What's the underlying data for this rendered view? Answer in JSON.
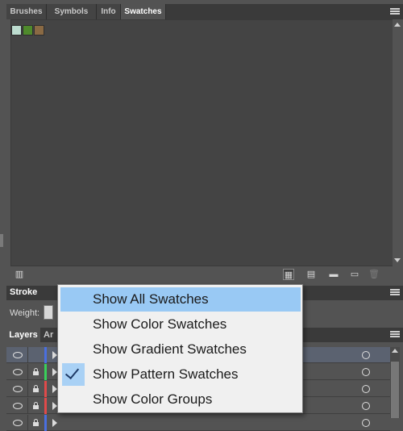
{
  "tabs": [
    {
      "label": "Brushes",
      "active": false
    },
    {
      "label": "Symbols",
      "active": false
    },
    {
      "label": "Info",
      "active": false
    },
    {
      "label": "Swatches",
      "active": true
    }
  ],
  "swatch_thumbnails": [
    {
      "name": "pattern-swatch-1",
      "color": "#bcdccf"
    },
    {
      "name": "pattern-swatch-2",
      "color": "#4f8a2c"
    },
    {
      "name": "pattern-swatch-3",
      "color": "#8a6a44"
    }
  ],
  "stroke_panel": {
    "title": "Stroke",
    "weight_label": "Weight:"
  },
  "layers_panel": {
    "tab_label": "Layers",
    "tab2_label": "Ar",
    "rows": [
      {
        "color": "#4a6fe0",
        "locked": false,
        "selected": true
      },
      {
        "color": "#39d05a",
        "locked": true,
        "selected": false
      },
      {
        "color": "#e04a4a",
        "locked": true,
        "selected": false
      },
      {
        "color": "#e04a4a",
        "locked": true,
        "selected": false
      },
      {
        "color": "#4a6fe0",
        "locked": true,
        "selected": false
      }
    ]
  },
  "popup_menu": {
    "items": [
      {
        "label": "Show All Swatches",
        "highlighted": true,
        "checked": false
      },
      {
        "label": "Show Color Swatches",
        "highlighted": false,
        "checked": false
      },
      {
        "label": "Show Gradient Swatches",
        "highlighted": false,
        "checked": false
      },
      {
        "label": "Show Pattern Swatches",
        "highlighted": false,
        "checked": true
      },
      {
        "label": "Show Color Groups",
        "highlighted": false,
        "checked": false
      }
    ]
  },
  "colors": {
    "panel_bg": "#535353",
    "menu_highlight": "#99c9f4",
    "menu_bg": "#f0f0f0"
  }
}
